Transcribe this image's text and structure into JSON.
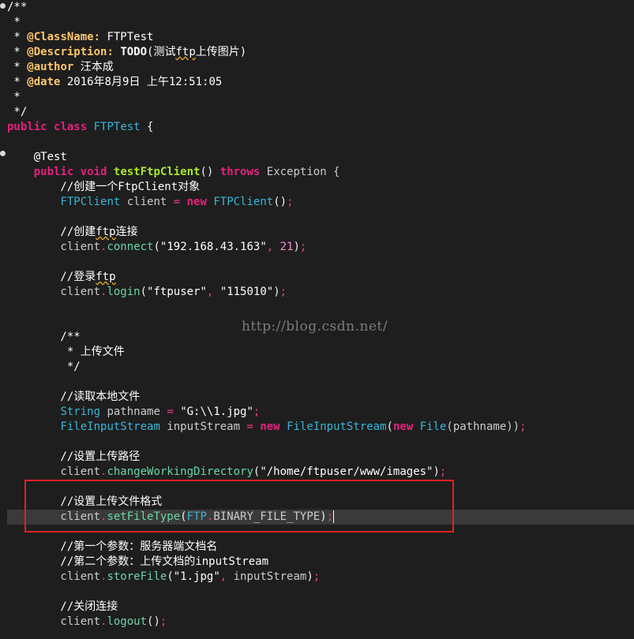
{
  "watermark": "http://blog.csdn.net/",
  "lines": [
    [
      {
        "t": "/**",
        "c": "com"
      }
    ],
    [
      {
        "t": " *",
        "c": "com"
      }
    ],
    [
      {
        "t": " * ",
        "c": "com"
      },
      {
        "t": "@ClassName:",
        "c": "tag"
      },
      {
        "t": " FTPTest",
        "c": "com"
      }
    ],
    [
      {
        "t": " * ",
        "c": "com"
      },
      {
        "t": "@Description:",
        "c": "tag"
      },
      {
        "t": " ",
        "c": "com"
      },
      {
        "t": "TODO",
        "c": "todo"
      },
      {
        "t": "(测试",
        "c": "com"
      },
      {
        "t": "ftp",
        "c": "com sq"
      },
      {
        "t": "上传图片)",
        "c": "com"
      }
    ],
    [
      {
        "t": " * ",
        "c": "com"
      },
      {
        "t": "@author",
        "c": "tag"
      },
      {
        "t": " 汪本成",
        "c": "com"
      }
    ],
    [
      {
        "t": " * ",
        "c": "com"
      },
      {
        "t": "@date",
        "c": "tag"
      },
      {
        "t": " 2016年8月9日 上午12:51:05",
        "c": "com"
      }
    ],
    [
      {
        "t": " *",
        "c": "com"
      }
    ],
    [
      {
        "t": " */",
        "c": "com"
      }
    ],
    [
      {
        "t": "public",
        "c": "kw"
      },
      {
        "t": " ",
        "c": ""
      },
      {
        "t": "class",
        "c": "kw"
      },
      {
        "t": " ",
        "c": ""
      },
      {
        "t": "FTPTest",
        "c": "cls"
      },
      {
        "t": " {",
        "c": ""
      }
    ],
    [
      {
        "t": "",
        "c": ""
      }
    ],
    [
      {
        "t": "    @Test",
        "c": "ann"
      }
    ],
    [
      {
        "t": "    ",
        "c": ""
      },
      {
        "t": "public",
        "c": "kw"
      },
      {
        "t": " ",
        "c": ""
      },
      {
        "t": "void",
        "c": "kw"
      },
      {
        "t": " ",
        "c": ""
      },
      {
        "t": "testFtpClient",
        "c": "fn"
      },
      {
        "t": "() ",
        "c": ""
      },
      {
        "t": "throws",
        "c": "kw"
      },
      {
        "t": " Exception {",
        "c": "gray"
      }
    ],
    [
      {
        "t": "        //创建一个FtpClient对象",
        "c": "com"
      }
    ],
    [
      {
        "t": "        ",
        "c": ""
      },
      {
        "t": "FTPClient",
        "c": "type"
      },
      {
        "t": " client ",
        "c": "gray"
      },
      {
        "t": "=",
        "c": "op"
      },
      {
        "t": " ",
        "c": ""
      },
      {
        "t": "new",
        "c": "kw"
      },
      {
        "t": " ",
        "c": ""
      },
      {
        "t": "FTPClient",
        "c": "type"
      },
      {
        "t": "()",
        "c": ""
      },
      {
        "t": ";",
        "c": "op"
      }
    ],
    [
      {
        "t": "",
        "c": ""
      }
    ],
    [
      {
        "t": "        //创建",
        "c": "com"
      },
      {
        "t": "ftp",
        "c": "com sq"
      },
      {
        "t": "连接",
        "c": "com"
      }
    ],
    [
      {
        "t": "        client",
        "c": "gray"
      },
      {
        "t": ".",
        "c": "op"
      },
      {
        "t": "connect",
        "c": "meth"
      },
      {
        "t": "(",
        "c": ""
      },
      {
        "t": "\"192.168.43.163\"",
        "c": "str"
      },
      {
        "t": ", ",
        "c": "op"
      },
      {
        "t": "21",
        "c": "num"
      },
      {
        "t": ")",
        "c": ""
      },
      {
        "t": ";",
        "c": "op"
      }
    ],
    [
      {
        "t": "",
        "c": ""
      }
    ],
    [
      {
        "t": "        //登录",
        "c": "com"
      },
      {
        "t": "ftp",
        "c": "com sq"
      }
    ],
    [
      {
        "t": "        client",
        "c": "gray"
      },
      {
        "t": ".",
        "c": "op"
      },
      {
        "t": "login",
        "c": "meth"
      },
      {
        "t": "(",
        "c": ""
      },
      {
        "t": "\"ftpuser\"",
        "c": "str"
      },
      {
        "t": ", ",
        "c": "op"
      },
      {
        "t": "\"115010\"",
        "c": "str"
      },
      {
        "t": ")",
        "c": ""
      },
      {
        "t": ";",
        "c": "op"
      }
    ],
    [
      {
        "t": "",
        "c": ""
      }
    ],
    [
      {
        "t": "",
        "c": ""
      }
    ],
    [
      {
        "t": "        /**",
        "c": "com"
      }
    ],
    [
      {
        "t": "         * 上传文件",
        "c": "com"
      }
    ],
    [
      {
        "t": "         */",
        "c": "com"
      }
    ],
    [
      {
        "t": "",
        "c": ""
      }
    ],
    [
      {
        "t": "        //读取本地文件",
        "c": "com"
      }
    ],
    [
      {
        "t": "        ",
        "c": ""
      },
      {
        "t": "String",
        "c": "type"
      },
      {
        "t": " pathname ",
        "c": "gray"
      },
      {
        "t": "=",
        "c": "op"
      },
      {
        "t": " ",
        "c": ""
      },
      {
        "t": "\"G:\\\\1.jpg\"",
        "c": "str"
      },
      {
        "t": ";",
        "c": "op"
      }
    ],
    [
      {
        "t": "        ",
        "c": ""
      },
      {
        "t": "FileInputStream",
        "c": "type"
      },
      {
        "t": " inputStream ",
        "c": "gray"
      },
      {
        "t": "=",
        "c": "op"
      },
      {
        "t": " ",
        "c": ""
      },
      {
        "t": "new",
        "c": "kw"
      },
      {
        "t": " ",
        "c": ""
      },
      {
        "t": "FileInputStream",
        "c": "type"
      },
      {
        "t": "(",
        "c": ""
      },
      {
        "t": "new",
        "c": "kw"
      },
      {
        "t": " ",
        "c": ""
      },
      {
        "t": "File",
        "c": "type"
      },
      {
        "t": "(pathname))",
        "c": "gray"
      },
      {
        "t": ";",
        "c": "op"
      }
    ],
    [
      {
        "t": "",
        "c": ""
      }
    ],
    [
      {
        "t": "        //设置上传路径",
        "c": "com"
      }
    ],
    [
      {
        "t": "        client",
        "c": "gray"
      },
      {
        "t": ".",
        "c": "op"
      },
      {
        "t": "changeWorkingDirectory",
        "c": "meth"
      },
      {
        "t": "(",
        "c": ""
      },
      {
        "t": "\"/home/ftpuser/www/images\"",
        "c": "str"
      },
      {
        "t": ")",
        "c": ""
      },
      {
        "t": ";",
        "c": "op"
      }
    ],
    [
      {
        "t": "",
        "c": ""
      }
    ],
    [
      {
        "t": "        //设置上传文件格式",
        "c": "com"
      }
    ],
    [
      {
        "t": "        client",
        "c": "gray"
      },
      {
        "t": ".",
        "c": "op"
      },
      {
        "t": "setFileType",
        "c": "meth"
      },
      {
        "t": "(",
        "c": ""
      },
      {
        "t": "FTP",
        "c": "type"
      },
      {
        "t": ".",
        "c": "op"
      },
      {
        "t": "BINARY_FILE_TYPE",
        "c": "gray"
      },
      {
        "t": ")",
        "c": ""
      },
      {
        "t": ";",
        "c": "op"
      }
    ],
    [
      {
        "t": "",
        "c": ""
      }
    ],
    [
      {
        "t": "        //第一个参数：服务器端文档名",
        "c": "com"
      }
    ],
    [
      {
        "t": "        //第二个参数：上传文档的inputStream",
        "c": "com"
      }
    ],
    [
      {
        "t": "        client",
        "c": "gray"
      },
      {
        "t": ".",
        "c": "op"
      },
      {
        "t": "storeFile",
        "c": "meth"
      },
      {
        "t": "(",
        "c": ""
      },
      {
        "t": "\"1.jpg\"",
        "c": "str"
      },
      {
        "t": ", ",
        "c": "op"
      },
      {
        "t": "inputStream",
        "c": "gray"
      },
      {
        "t": ")",
        "c": ""
      },
      {
        "t": ";",
        "c": "op"
      }
    ],
    [
      {
        "t": "",
        "c": ""
      }
    ],
    [
      {
        "t": "        //关闭连接",
        "c": "com"
      }
    ],
    [
      {
        "t": "        client",
        "c": "gray"
      },
      {
        "t": ".",
        "c": "op"
      },
      {
        "t": "logout",
        "c": "meth"
      },
      {
        "t": "()",
        "c": ""
      },
      {
        "t": ";",
        "c": "op"
      }
    ]
  ]
}
